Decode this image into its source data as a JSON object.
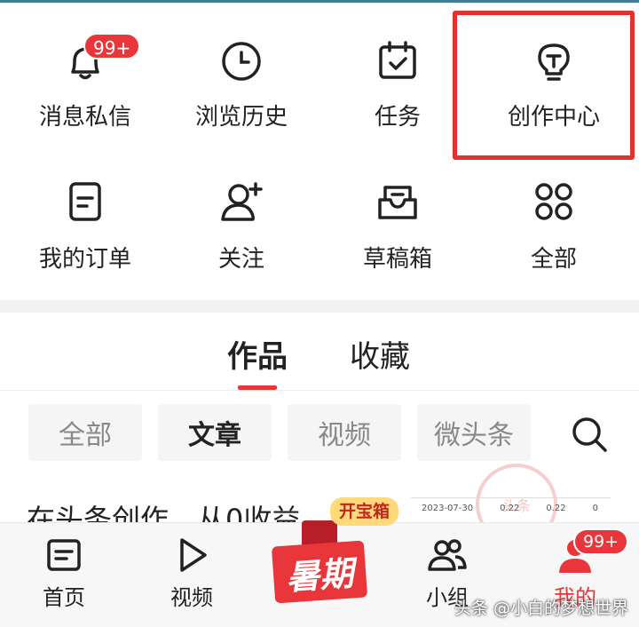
{
  "grid": {
    "row1": [
      {
        "label": "消息私信",
        "icon": "bell-icon",
        "badge": "99+"
      },
      {
        "label": "浏览历史",
        "icon": "clock-icon"
      },
      {
        "label": "任务",
        "icon": "calendar-check-icon"
      },
      {
        "label": "创作中心",
        "icon": "lightbulb-icon"
      }
    ],
    "row2": [
      {
        "label": "我的订单",
        "icon": "order-doc-icon"
      },
      {
        "label": "关注",
        "icon": "user-add-icon"
      },
      {
        "label": "草稿箱",
        "icon": "inbox-icon"
      },
      {
        "label": "全部",
        "icon": "grid-circles-icon"
      }
    ]
  },
  "tabs": [
    {
      "label": "作品",
      "active": true
    },
    {
      "label": "收藏",
      "active": false
    }
  ],
  "filters": [
    {
      "label": "全部",
      "active": false
    },
    {
      "label": "文章",
      "active": true
    },
    {
      "label": "视频",
      "active": false
    },
    {
      "label": "微头条",
      "active": false
    }
  ],
  "article": {
    "title_peek": "在头条创作，从0收益",
    "thumb_values": [
      "2023-07-30",
      "0.22",
      "0.22",
      "0"
    ],
    "stamp": "头条"
  },
  "promo": {
    "summer": "暑期",
    "treasure": "开宝箱"
  },
  "bottom_nav": [
    {
      "label": "首页",
      "icon": "home-list-icon",
      "active": false
    },
    {
      "label": "视频",
      "icon": "play-icon",
      "active": false
    },
    {
      "label": "小组",
      "icon": "group-icon",
      "active": false
    },
    {
      "label": "我的",
      "icon": "profile-icon",
      "active": true,
      "badge": "99+"
    }
  ],
  "watermark": "头条 @小白的梦想世界",
  "colors": {
    "accent": "#e8363a",
    "highlight": "#e0322f"
  }
}
